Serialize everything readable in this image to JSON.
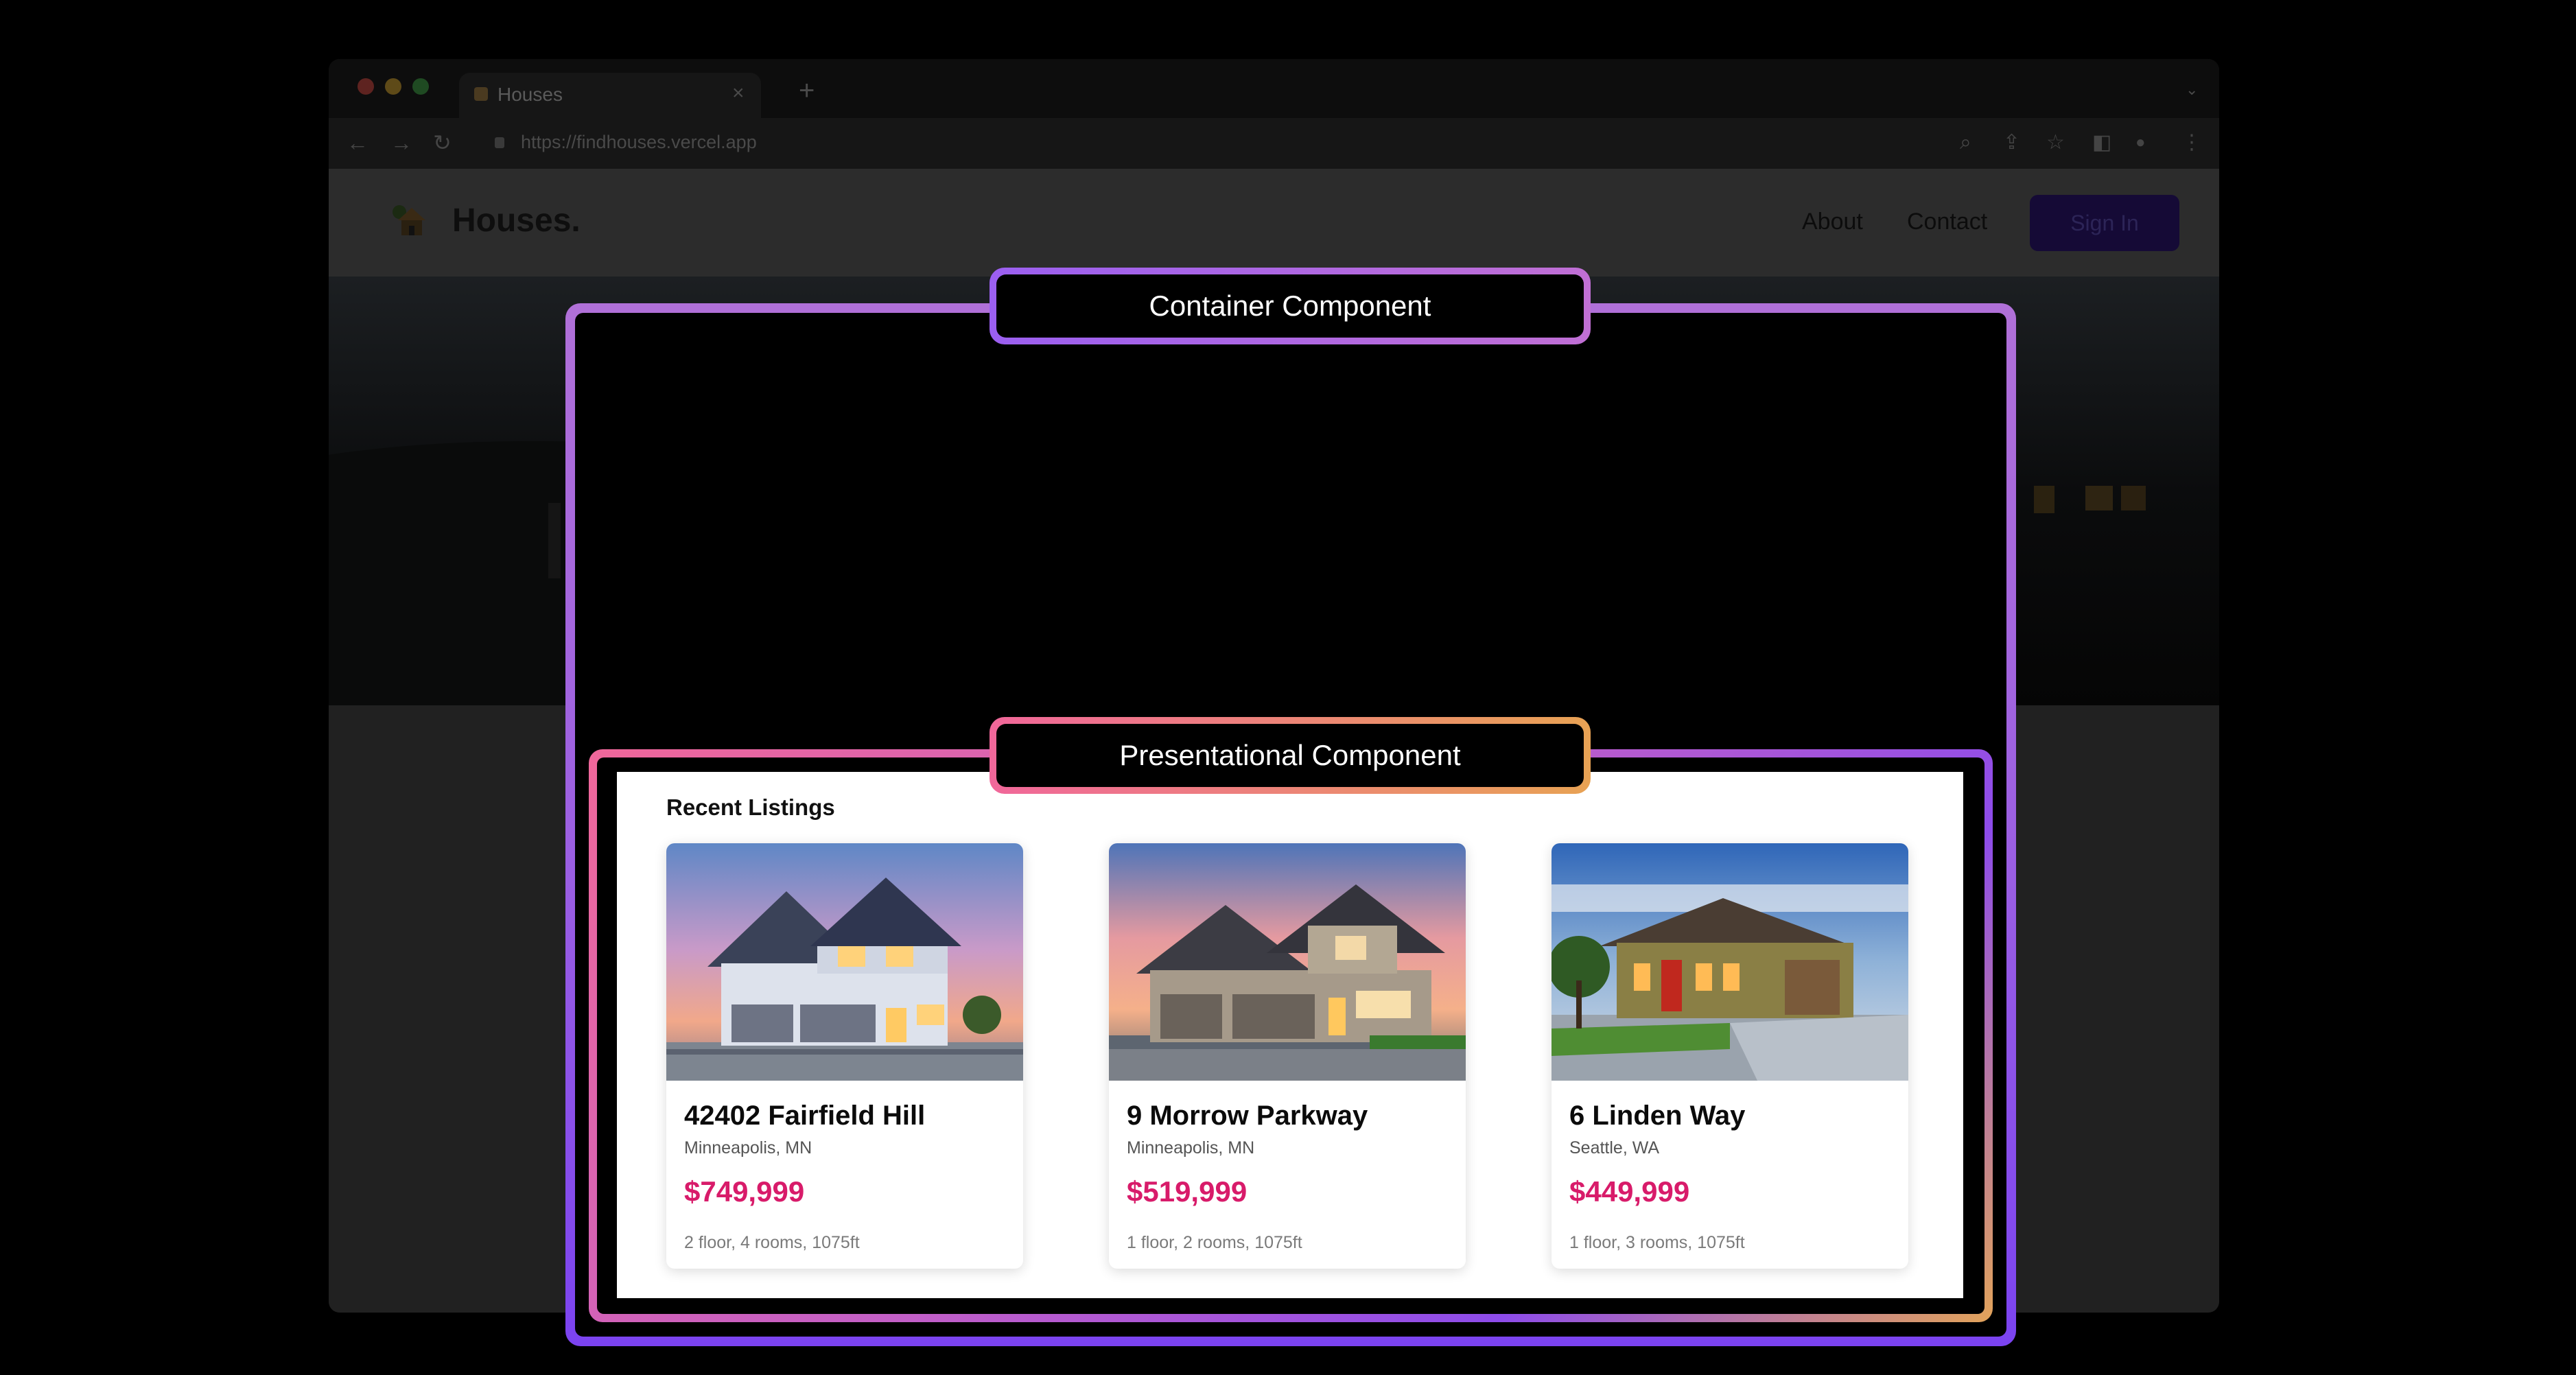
{
  "colors": {
    "container_gradient": [
      "#b070d8",
      "#7b43f0"
    ],
    "presentational_gradient": [
      "#f0679a",
      "#8d4cea",
      "#e2a35a"
    ],
    "price": "#d81b6a",
    "sign_in": "#150a36"
  },
  "browser": {
    "tab_title": "Houses",
    "tab_close": "×",
    "new_tab": "+",
    "tab_menu": "⌄",
    "url": "https://findhouses.vercel.app",
    "icons": [
      "back-arrow-icon",
      "forward-arrow-icon",
      "reload-icon",
      "zoom-icon",
      "share-icon",
      "bookmark-star-icon",
      "side-panel-icon",
      "profile-icon",
      "menu-dots-icon"
    ],
    "back": "←",
    "forward": "→",
    "reload": "↻",
    "zoom": "⌕",
    "share": "⇪",
    "star": "☆",
    "panel": "◧",
    "profile": "●",
    "menu": "⋮"
  },
  "site": {
    "logo": "Houses.",
    "nav": {
      "about": "About",
      "contact": "Contact",
      "sign_in": "Sign In"
    }
  },
  "annotations": {
    "container_label": "Container Component",
    "presentational_label": "Presentational Component"
  },
  "listings": {
    "title": "Recent Listings",
    "items": [
      {
        "address": "42402 Fairfield Hill",
        "city": "Minneapolis, MN",
        "price": "$749,999",
        "specs": "2 floor, 4 rooms, 1075ft"
      },
      {
        "address": "9 Morrow Parkway",
        "city": "Minneapolis, MN",
        "price": "$519,999",
        "specs": "1 floor, 2 rooms, 1075ft"
      },
      {
        "address": "6 Linden Way",
        "city": "Seattle, WA",
        "price": "$449,999",
        "specs": "1 floor, 3 rooms, 1075ft"
      }
    ]
  }
}
